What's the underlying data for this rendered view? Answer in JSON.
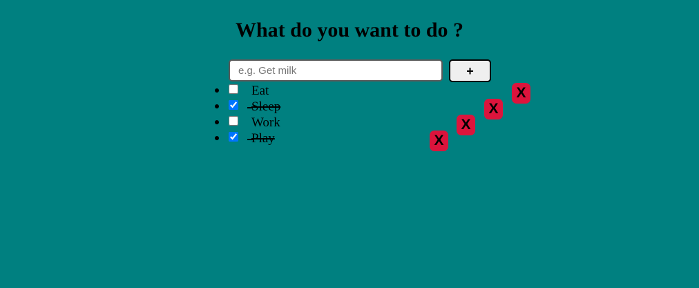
{
  "header": {
    "title": "What do you want to do ?"
  },
  "form": {
    "input_placeholder": "e.g. Get milk",
    "input_value": "",
    "add_label": "+"
  },
  "todos": [
    {
      "label": "Eat",
      "checked": false,
      "delete_label": "X"
    },
    {
      "label": "Sleep",
      "checked": true,
      "delete_label": "X"
    },
    {
      "label": "Work",
      "checked": false,
      "delete_label": "X"
    },
    {
      "label": "Play",
      "checked": true,
      "delete_label": "X"
    }
  ],
  "colors": {
    "background": "#008080",
    "delete_button": "#dc143c",
    "checkbox_checked": "#0075ff"
  }
}
